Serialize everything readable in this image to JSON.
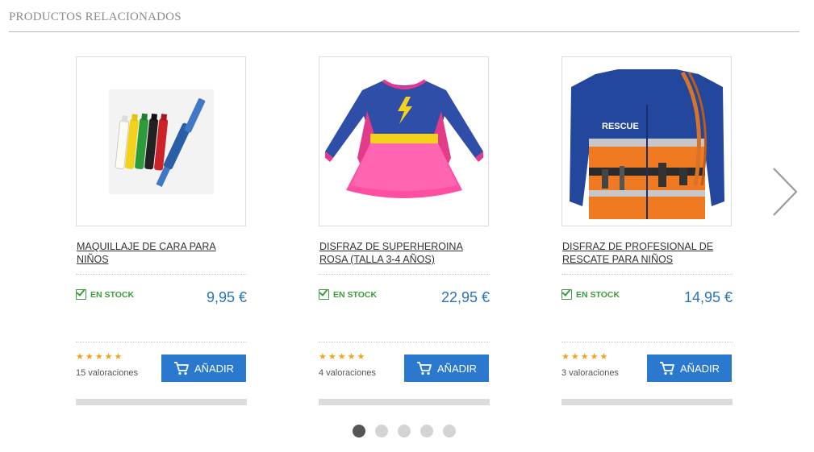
{
  "section": {
    "title": "PRODUCTOS RELACIONADOS"
  },
  "products": [
    {
      "name": "MAQUILLAJE DE CARA PARA NIÑOS",
      "stock": "EN STOCK",
      "price": "9,95 €",
      "stars": "★★★★★",
      "ratings": "15 valoraciones",
      "add_label": "AÑADIR"
    },
    {
      "name": "DISFRAZ DE SUPERHEROINA ROSA (TALLA 3-4 AÑOS)",
      "stock": "EN STOCK",
      "price": "22,95 €",
      "stars": "★★★★★",
      "ratings": "4 valoraciones",
      "add_label": "AÑADIR"
    },
    {
      "name": "DISFRAZ DE PROFESIONAL DE RESCATE PARA NIÑOS",
      "stock": "EN STOCK",
      "price": "14,95 €",
      "stars": "★★★★★",
      "ratings": "3 valoraciones",
      "add_label": "AÑADIR"
    }
  ],
  "images": {
    "badge_text": "RESCUE"
  },
  "carousel": {
    "dot_count": 5,
    "active_index": 0
  },
  "icons": {
    "next": "chevron-right-icon",
    "cart": "cart-icon",
    "stock": "checkbox-check-icon",
    "star": "star-icon"
  },
  "colors": {
    "accent": "#2a79cf",
    "price": "#2b73b8",
    "stock": "#3c9c3c",
    "stars": "#f4a11b"
  }
}
